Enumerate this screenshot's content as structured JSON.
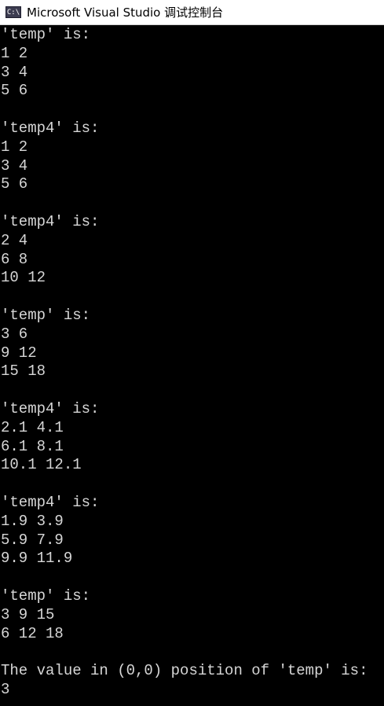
{
  "window": {
    "title": "Microsoft Visual Studio 调试控制台",
    "icon": "C:\\"
  },
  "console": {
    "lines": [
      "'temp' is:",
      "1 2",
      "3 4",
      "5 6",
      "",
      "'temp4' is:",
      "1 2",
      "3 4",
      "5 6",
      "",
      "'temp4' is:",
      "2 4",
      "6 8",
      "10 12",
      "",
      "'temp' is:",
      "3 6",
      "9 12",
      "15 18",
      "",
      "'temp4' is:",
      "2.1 4.1",
      "6.1 8.1",
      "10.1 12.1",
      "",
      "'temp4' is:",
      "1.9 3.9",
      "5.9 7.9",
      "9.9 11.9",
      "",
      "'temp' is:",
      "3 9 15",
      "6 12 18",
      "",
      "The value in (0,0) position of 'temp' is:",
      "3"
    ]
  }
}
